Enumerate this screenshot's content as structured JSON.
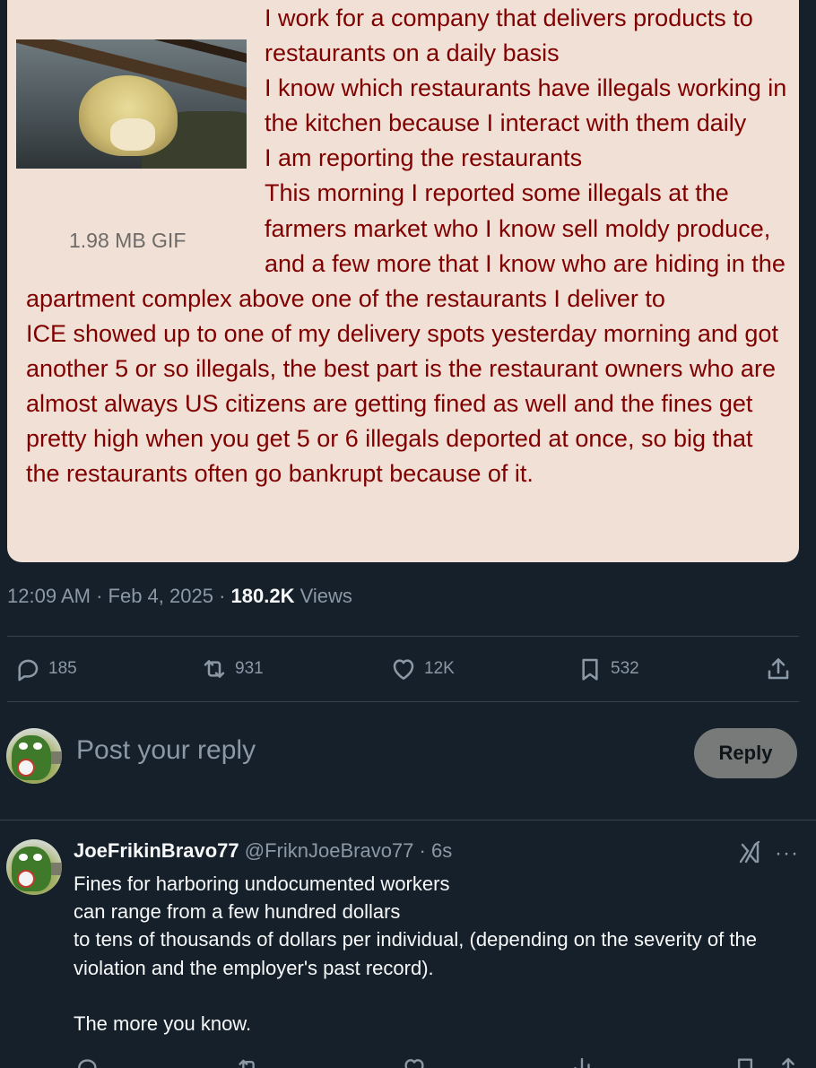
{
  "post": {
    "image": {
      "gif_label": "1.98 MB GIF",
      "greentext_lines": [
        "I work for a company that delivers products to restaurants on a daily basis",
        "I know which restaurants have illegals working in the kitchen because I interact with them daily",
        "I am reporting the restaurants",
        "This morning I reported some illegals at the farmers market who I know sell moldy produce, and a few more that I know who are hiding in the apartment complex above one of the restaurants I deliver to",
        "ICE showed up to one of my delivery spots yesterday morning and got another 5 or so illegals, the best part is the restaurant owners who are almost always US citizens are getting fined as well and the fines get pretty high when you get 5 or 6 illegals deported at once, so big that the restaurants often go bankrupt because of it."
      ]
    },
    "meta": {
      "time": "12:09 AM",
      "separator": "·",
      "date": "Feb 4, 2025",
      "views_count": "180.2K",
      "views_label": "Views"
    },
    "actions": {
      "replies": "185",
      "reposts": "931",
      "likes": "12K",
      "bookmarks": "532"
    }
  },
  "composer": {
    "placeholder": "Post your reply",
    "button_label": "Reply"
  },
  "reply": {
    "display_name": "JoeFrikinBravo77",
    "handle": "@FriknJoeBravo77",
    "separator": "·",
    "time": "6s",
    "more": "···",
    "body_lines": [
      "Fines for harboring undocumented workers",
      "can range from a few hundred dollars",
      "to tens of thousands of dollars per individual, (depending on the severity of the violation and the employer's past record).",
      "",
      "The more you know."
    ]
  },
  "colors": {
    "background": "#15202b",
    "card_background": "#f0e0d6",
    "greentext": "#800000",
    "muted": "#8b98a5",
    "divider": "#38444d",
    "reply_button": "#787a7a"
  },
  "icons": {
    "replies": "comment-icon",
    "reposts": "repost-icon",
    "likes": "heart-icon",
    "bookmarks": "bookmark-icon",
    "share": "share-icon",
    "grok": "grok-icon",
    "more": "more-icon"
  }
}
